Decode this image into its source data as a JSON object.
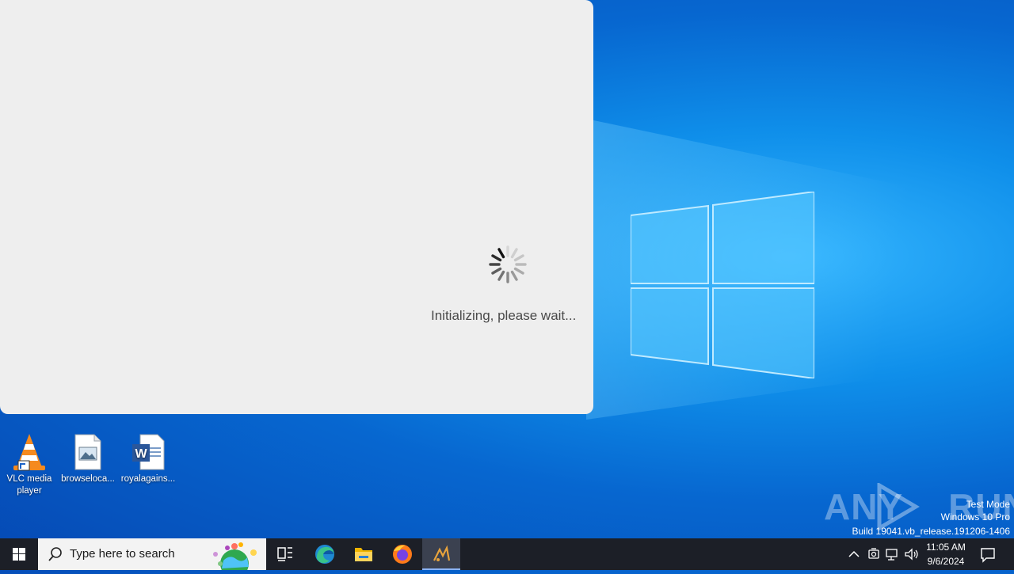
{
  "dialog": {
    "status_text": "Initializing, please wait..."
  },
  "desktop": {
    "icons": [
      {
        "label_line1": "VLC media",
        "label_line2": "player",
        "icon": "vlc-cone-icon"
      },
      {
        "label_line1": "browseloca...",
        "label_line2": "",
        "icon": "image-file-icon"
      },
      {
        "label_line1": "royalagains...",
        "label_line2": "",
        "icon": "word-document-icon"
      }
    ]
  },
  "watermark": {
    "brand": "ANY RUN",
    "line1": "Test Mode",
    "line2": "Windows 10 Pro",
    "line3": "Build 19041.vb_release.191206-1406"
  },
  "taskbar": {
    "search_placeholder": "Type here to search",
    "apps": [
      "task-view-icon",
      "edge-icon",
      "file-explorer-icon",
      "firefox-icon",
      "active-app-icon"
    ],
    "time": "11:05 AM",
    "date": "9/6/2024"
  },
  "colors": {
    "desktop_blue": "#0f8fea",
    "dialog_bg": "#eeeeee",
    "taskbar_bg": "#1c1f27"
  }
}
